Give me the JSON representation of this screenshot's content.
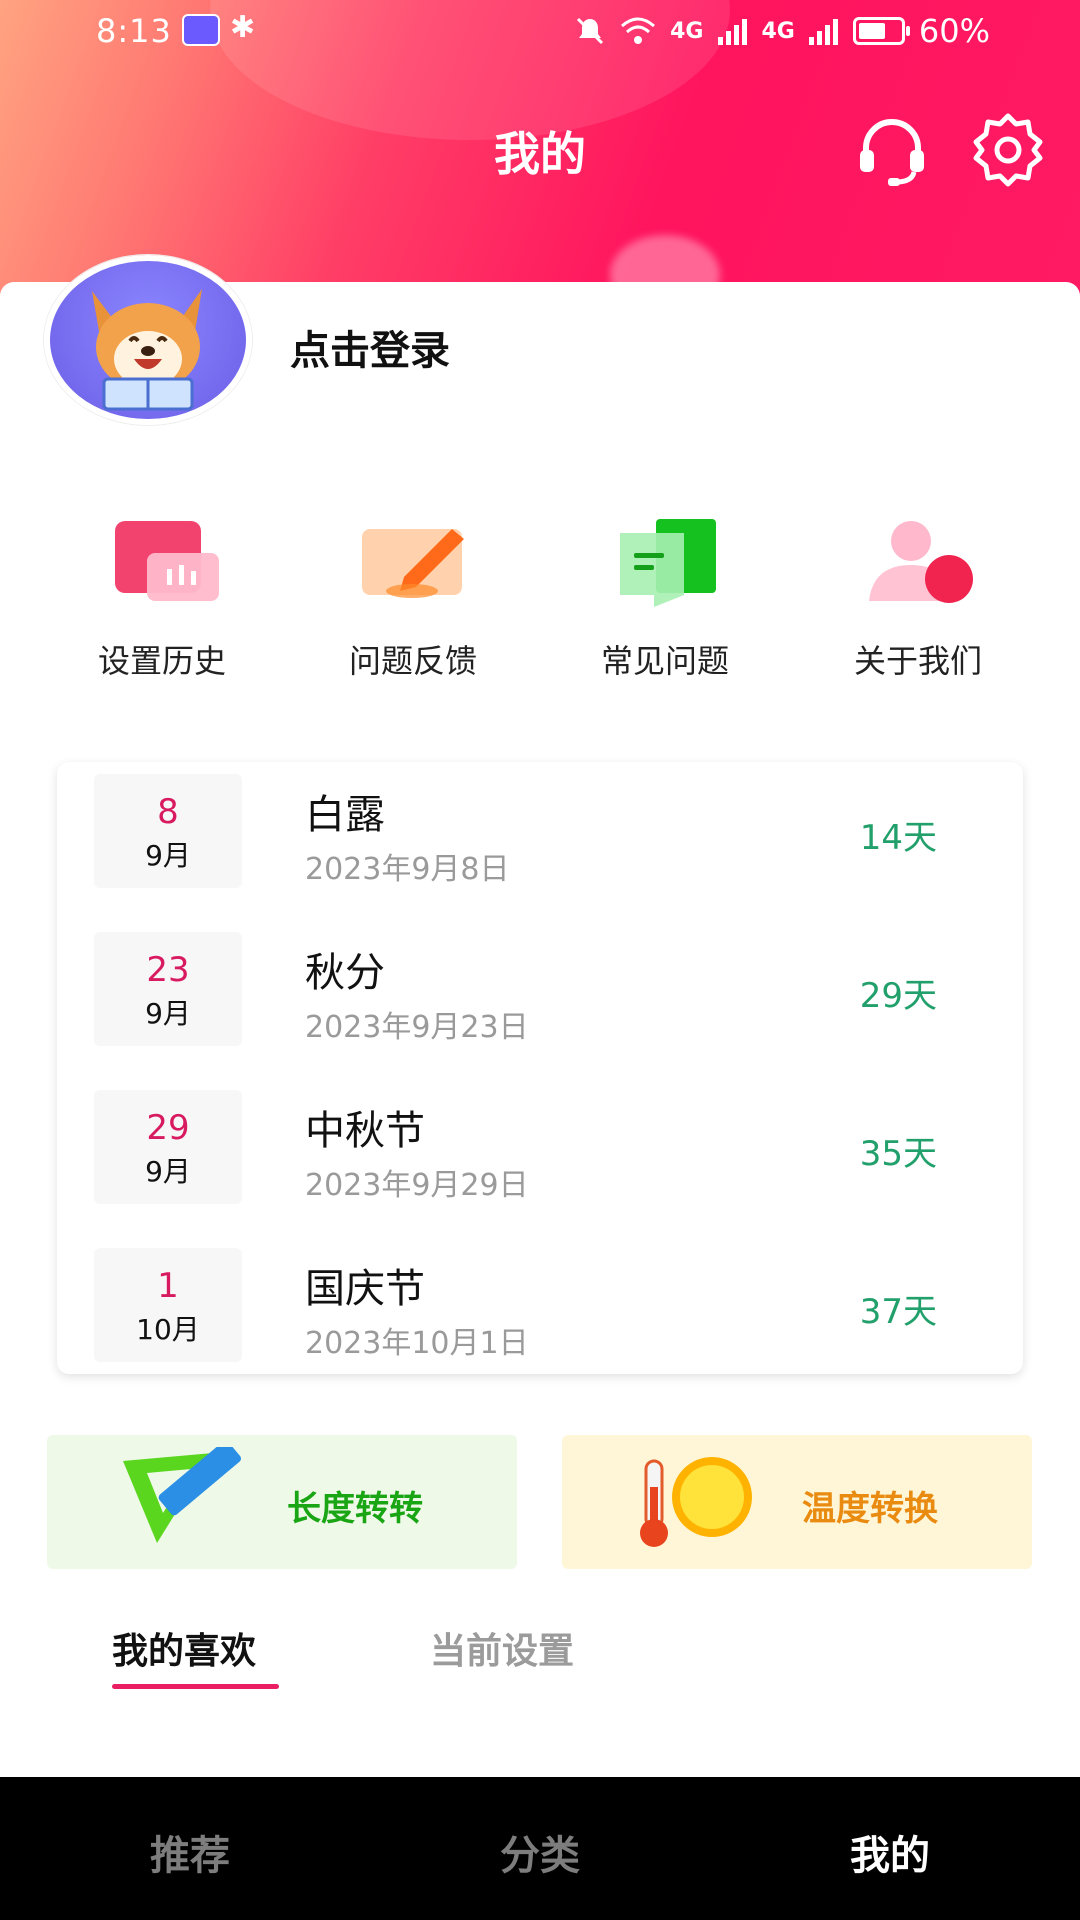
{
  "status_bar": {
    "time": "8:13",
    "battery": "60%",
    "signal1": "4G",
    "signal2": "4G"
  },
  "header": {
    "title": "我的",
    "icons": [
      "headset-icon",
      "settings-icon"
    ]
  },
  "profile": {
    "login_text": "点击登录"
  },
  "actions": [
    {
      "label": "设置历史",
      "icon": "history-icon"
    },
    {
      "label": "问题反馈",
      "icon": "feedback-icon"
    },
    {
      "label": "常见问题",
      "icon": "faq-icon"
    },
    {
      "label": "关于我们",
      "icon": "about-icon"
    }
  ],
  "festivals": [
    {
      "day": "8",
      "month": "9月",
      "name": "白露",
      "date": "2023年9月8日",
      "days": "14天"
    },
    {
      "day": "23",
      "month": "9月",
      "name": "秋分",
      "date": "2023年9月23日",
      "days": "29天"
    },
    {
      "day": "29",
      "month": "9月",
      "name": "中秋节",
      "date": "2023年9月29日",
      "days": "35天"
    },
    {
      "day": "1",
      "month": "10月",
      "name": "国庆节",
      "date": "2023年10月1日",
      "days": "37天"
    }
  ],
  "tools": {
    "length": "长度转转",
    "temperature": "温度转换"
  },
  "tabs": {
    "favorites": "我的喜欢",
    "current": "当前设置"
  },
  "bottom_nav": {
    "recommend": "推荐",
    "category": "分类",
    "mine": "我的"
  },
  "colors": {
    "accent": "#e91e63",
    "days_green": "#22a06b"
  }
}
